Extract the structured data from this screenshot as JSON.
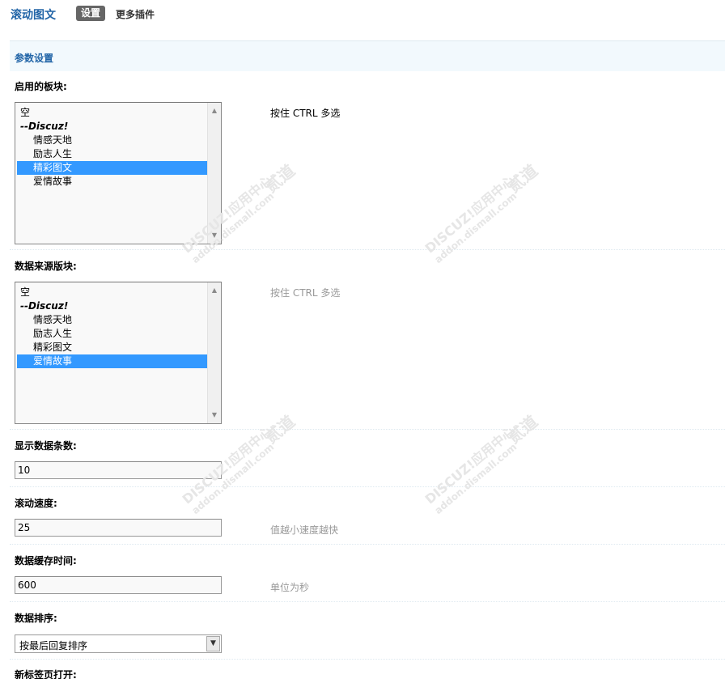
{
  "header": {
    "plugin_title": "滚动图文",
    "tab_settings": "设置",
    "tab_more": "更多插件"
  },
  "section": {
    "title": "参数设置"
  },
  "fields": {
    "enabled_boards": {
      "label": "启用的板块:",
      "note": "按住 CTRL 多选",
      "options": [
        {
          "text": "空",
          "kind": "plain",
          "selected": false
        },
        {
          "text": "--Discuz!",
          "kind": "group",
          "selected": false
        },
        {
          "text": "情感天地",
          "kind": "indent",
          "selected": false
        },
        {
          "text": "励志人生",
          "kind": "indent",
          "selected": false
        },
        {
          "text": "精彩图文",
          "kind": "indent",
          "selected": true
        },
        {
          "text": "爱情故事",
          "kind": "indent",
          "selected": false
        }
      ]
    },
    "source_boards": {
      "label": "数据来源版块:",
      "note": "按住 CTRL 多选",
      "options": [
        {
          "text": "空",
          "kind": "plain",
          "selected": false
        },
        {
          "text": "--Discuz!",
          "kind": "group",
          "selected": false
        },
        {
          "text": "情感天地",
          "kind": "indent",
          "selected": false
        },
        {
          "text": "励志人生",
          "kind": "indent",
          "selected": false
        },
        {
          "text": "精彩图文",
          "kind": "indent",
          "selected": false
        },
        {
          "text": "爱情故事",
          "kind": "indent",
          "selected": true
        }
      ]
    },
    "item_count": {
      "label": "显示数据条数:",
      "value": "10"
    },
    "scroll_speed": {
      "label": "滚动速度:",
      "value": "25",
      "note": "值越小速度越快"
    },
    "cache_time": {
      "label": "数据缓存时间:",
      "value": "600",
      "note": "单位为秒"
    },
    "sort_order": {
      "label": "数据排序:",
      "value": "按最后回复排序"
    },
    "new_tab": {
      "label": "新标签页打开:"
    }
  },
  "watermark": {
    "text1": "DISCUZ!应用中心",
    "text2": "addon.dismall.com",
    "text3": "贰道"
  }
}
